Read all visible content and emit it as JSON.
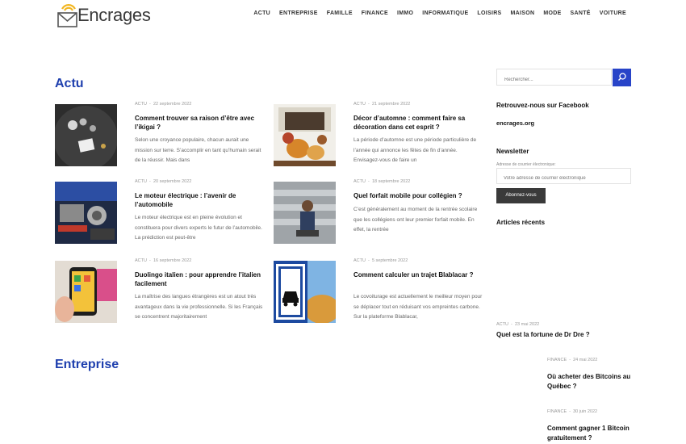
{
  "site": {
    "name": "Encrages"
  },
  "nav": [
    "ACTU",
    "ENTREPRISE",
    "FAMILLE",
    "FINANCE",
    "IMMO",
    "INFORMATIQUE",
    "LOISIRS",
    "MAISON",
    "MODE",
    "SANTÉ",
    "VOITURE"
  ],
  "sections": {
    "actu": {
      "title": "Actu",
      "articles": [
        {
          "category": "ACTU",
          "date": "22 septembre 2022",
          "title": "Comment trouver sa raison d’être avec l’ikigai ?",
          "excerpt": "Selon une croyance populaire, chacun aurait une mission sur terre. S’accomplir en tant qu’humain serait de la réussir. Mais dans"
        },
        {
          "category": "ACTU",
          "date": "21 septembre 2022",
          "title": "Décor d’automne : comment faire sa décoration dans cet esprit ?",
          "excerpt": "La période d’automne est une période particulière de l’année qui annonce les fêtes de fin d’année. Envisagez-vous de faire un"
        },
        {
          "category": "ACTU",
          "date": "20 septembre 2022",
          "title": "Le moteur électrique : l’avenir de l’automobile",
          "excerpt": "Le moteur électrique est en pleine évolution et constituera pour divers experts le futur de l’automobile. La prédiction est peut-être"
        },
        {
          "category": "ACTU",
          "date": "18 septembre 2022",
          "title": "Quel forfait mobile pour collégien ?",
          "excerpt": "C’est généralement au moment de la rentrée scolaire que les collégiens ont leur premier forfait mobile. En effet, la rentrée"
        },
        {
          "category": "ACTU",
          "date": "16 septembre 2022",
          "title": "Duolingo italien : pour apprendre l’italien facilement",
          "excerpt": "La maîtrise des langues étrangères est un atout très avantageux dans la vie professionnelle. Si les Français se concentrent majoritairement"
        },
        {
          "category": "ACTU",
          "date": "5 septembre 2022",
          "title": "Comment calculer un trajet Blablacar ?",
          "excerpt": "Le covoiturage est actuellement le meilleur moyen pour se déplacer tout en réduisant vos empreintes carbone. Sur la plateforme Blablacar,"
        }
      ]
    },
    "entreprise": {
      "title": "Entreprise"
    }
  },
  "sidebar": {
    "search_placeholder": "Rechercher...",
    "facebook_heading": "Retrouvez-nous sur Facebook",
    "facebook_link": "encrages.org",
    "newsletter_heading": "Newsletter",
    "newsletter_label": "Adresse de courrier électronique:",
    "newsletter_placeholder": "Votre adresse de courrier électronique",
    "newsletter_button": "Abonnez-vous",
    "recent_heading": "Articles récents",
    "recent": [
      {
        "category": "ACTU",
        "date": "23 mai 2022",
        "title": "Quel est la fortune de Dr Dre ?"
      },
      {
        "category": "FINANCE",
        "date": "24 mai 2022",
        "title": "Où acheter des Bitcoins au Québec ?"
      },
      {
        "category": "FINANCE",
        "date": "30 juin 2022",
        "title": "Comment gagner 1 Bitcoin gratuitement ?"
      }
    ]
  },
  "colors": {
    "accent": "#1e3fae",
    "button_blue": "#2844c8",
    "logo_yellow": "#f2b51e"
  }
}
